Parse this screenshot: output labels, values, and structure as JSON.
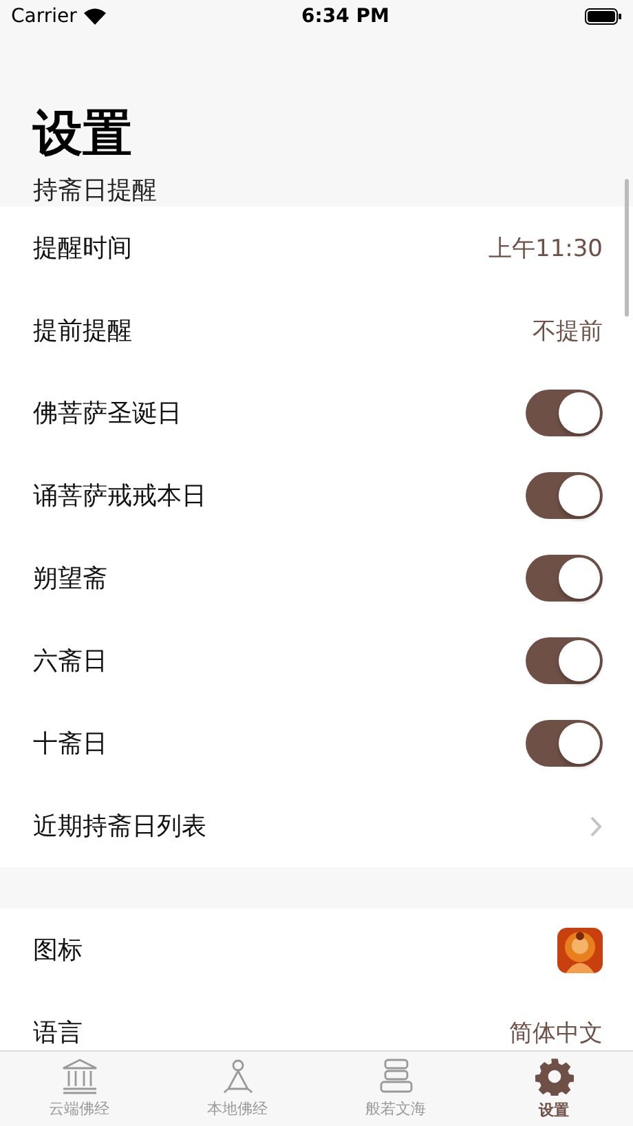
{
  "status_bar": {
    "carrier": "Carrier",
    "time": "6:34 PM"
  },
  "title": "设置",
  "sections": [
    {
      "header": "持斋日提醒",
      "rows": [
        {
          "kind": "value",
          "label": "提醒时间",
          "value": "上午11:30"
        },
        {
          "kind": "value",
          "label": "提前提醒",
          "value": "不提前"
        },
        {
          "kind": "toggle",
          "label": "佛菩萨圣诞日",
          "on": true
        },
        {
          "kind": "toggle",
          "label": "诵菩萨戒戒本日",
          "on": true
        },
        {
          "kind": "toggle",
          "label": "朔望斋",
          "on": true
        },
        {
          "kind": "toggle",
          "label": "六斋日",
          "on": true
        },
        {
          "kind": "toggle",
          "label": "十斋日",
          "on": true
        },
        {
          "kind": "link",
          "label": "近期持斋日列表"
        }
      ]
    },
    {
      "rows": [
        {
          "kind": "icon",
          "label": "图标"
        },
        {
          "kind": "value",
          "label": "语言",
          "value": "简体中文"
        }
      ]
    }
  ],
  "tab_bar": [
    {
      "kind": "temple",
      "label": "云端佛经",
      "selected": false
    },
    {
      "kind": "person",
      "label": "本地佛经",
      "selected": false
    },
    {
      "kind": "books",
      "label": "般若文海",
      "selected": false
    },
    {
      "kind": "gear",
      "label": "设置",
      "selected": true
    }
  ]
}
